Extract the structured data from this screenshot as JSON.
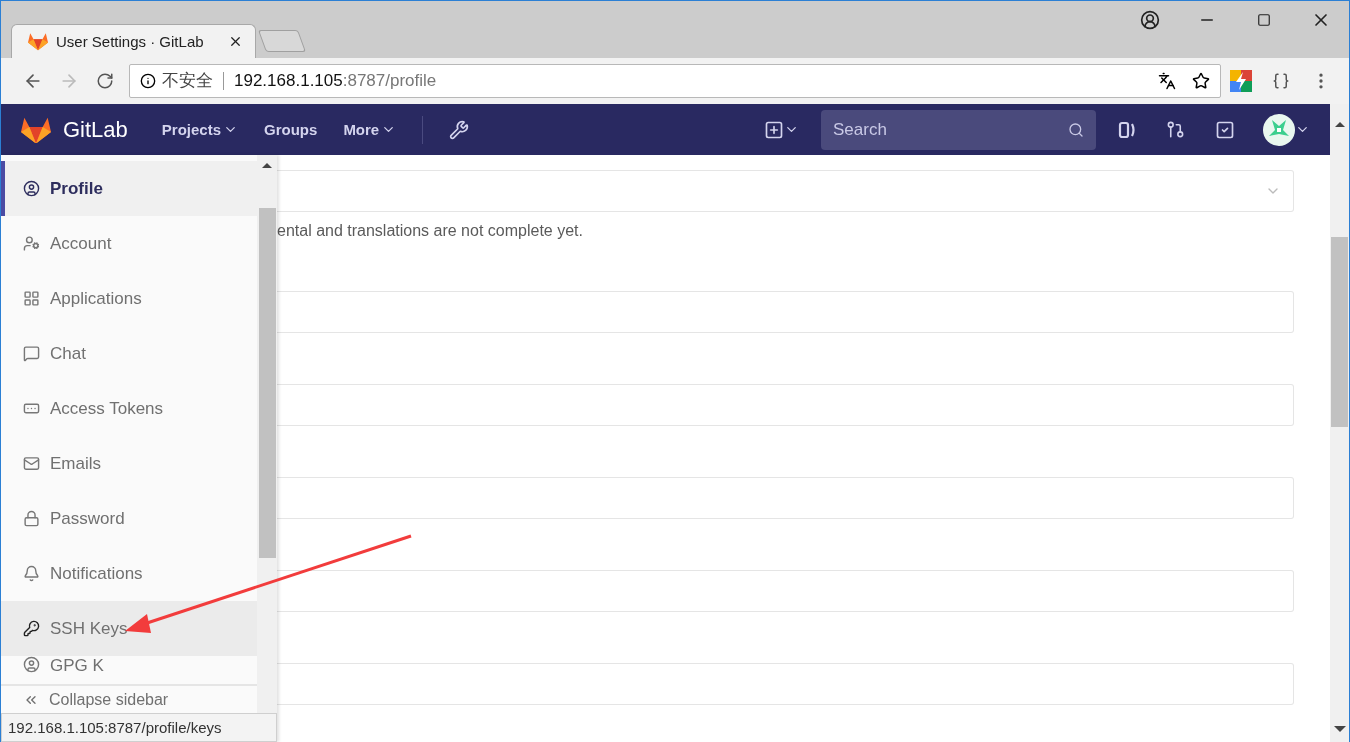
{
  "browser": {
    "tabs": [
      {
        "title": "User Settings · GitLab",
        "selected": true
      }
    ],
    "address": {
      "security_label": "不安全",
      "host": "192.168.1.105",
      "rest": ":8787/profile"
    }
  },
  "navbar": {
    "brand": "GitLab",
    "links": [
      {
        "label": "Projects",
        "dropdown": true
      },
      {
        "label": "Groups",
        "dropdown": false
      },
      {
        "label": "More",
        "dropdown": true
      }
    ],
    "search": {
      "placeholder": "Search"
    }
  },
  "sidebar": {
    "items": [
      {
        "label": "Profile",
        "selected": true,
        "hovered": false
      },
      {
        "label": "Account",
        "selected": false,
        "hovered": false
      },
      {
        "label": "Applications",
        "selected": false,
        "hovered": false
      },
      {
        "label": "Chat",
        "selected": false,
        "hovered": false
      },
      {
        "label": "Access Tokens",
        "selected": false,
        "hovered": false
      },
      {
        "label": "Emails",
        "selected": false,
        "hovered": false
      },
      {
        "label": "Password",
        "selected": false,
        "hovered": false
      },
      {
        "label": "Notifications",
        "selected": false,
        "hovered": false
      },
      {
        "label": "SSH Keys",
        "selected": false,
        "hovered": true
      },
      {
        "label": "GPG K",
        "selected": false,
        "hovered": false
      }
    ],
    "collapse_label": "Collapse sidebar"
  },
  "content": {
    "notice": "ental and translations are not complete yet.",
    "fields": [
      {
        "kind": "select"
      },
      {
        "kind": "input"
      },
      {
        "kind": "input"
      },
      {
        "kind": "input"
      },
      {
        "kind": "input"
      },
      {
        "kind": "input"
      }
    ]
  },
  "status_bar": "192.168.1.105:8787/profile/keys"
}
